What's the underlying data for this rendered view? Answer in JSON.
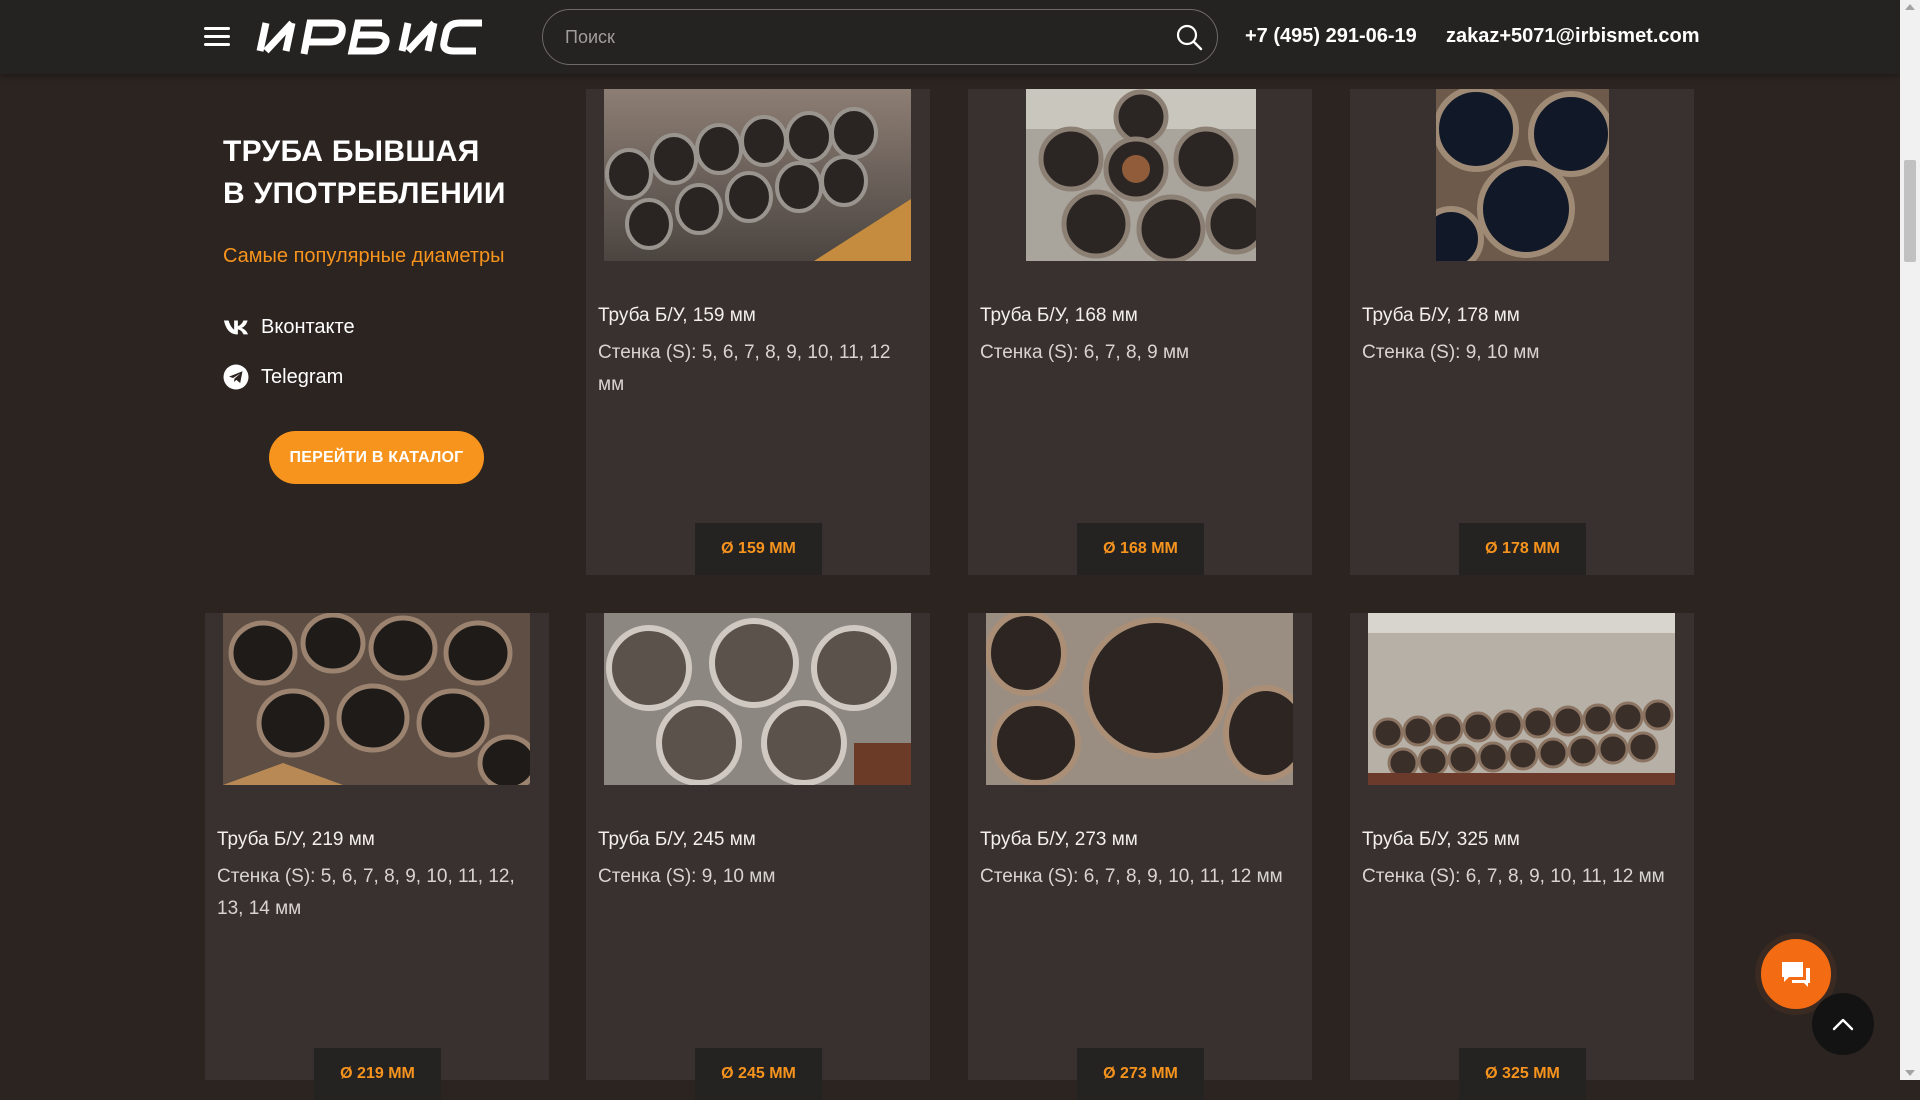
{
  "header": {
    "logo_text": "ИРБИС",
    "menu_icon": "hamburger-menu-icon",
    "search": {
      "placeholder": "Поиск",
      "value": "",
      "icon": "search-icon"
    },
    "phone": "+7 (495) 291-06-19",
    "email": "zakaz+5071@irbismet.com"
  },
  "info": {
    "title_line1": "ТРУБА БЫВШАЯ",
    "title_line2": "В УПОТРЕБЛЕНИИ",
    "subtitle": "Самые популярные диаметры",
    "social": [
      {
        "label": "Вконтакте",
        "icon": "vk-icon"
      },
      {
        "label": "Telegram",
        "icon": "telegram-icon"
      }
    ],
    "catalog_button": "ПЕРЕЙТИ В КАТАЛОГ"
  },
  "cards": [
    {
      "title": "Труба Б/У, 159 мм",
      "wall": "Стенка (S): 5, 6, 7, 8, 9, 10, 11, 12 мм",
      "badge": "Ø 159 ММ"
    },
    {
      "title": "Труба Б/У, 168 мм",
      "wall": "Стенка (S): 6, 7, 8, 9 мм",
      "badge": "Ø 168 ММ"
    },
    {
      "title": "Труба Б/У, 178 мм",
      "wall": "Стенка (S): 9, 10 мм",
      "badge": "Ø 178 ММ"
    },
    {
      "title": "Труба Б/У, 219 мм",
      "wall": "Стенка (S): 5, 6, 7, 8, 9, 10, 11, 12, 13, 14 мм",
      "badge": "Ø 219 ММ"
    },
    {
      "title": "Труба Б/У, 245 мм",
      "wall": "Стенка (S): 9, 10 мм",
      "badge": "Ø 245 ММ"
    },
    {
      "title": "Труба Б/У, 273 мм",
      "wall": "Стенка (S): 6, 7, 8, 9, 10, 11, 12 мм",
      "badge": "Ø 273 ММ"
    },
    {
      "title": "Труба Б/У, 325 мм",
      "wall": "Стенка (S): 6, 7, 8, 9, 10, 11, 12 мм",
      "badge": "Ø 325 ММ"
    }
  ],
  "floating": {
    "chat_icon": "chat-bubble-icon",
    "top_icon": "chevron-up-icon"
  },
  "colors": {
    "accent": "#f7941d",
    "background": "#2c2421",
    "card": "#383130",
    "header": "#252322",
    "chat": "#f36b12"
  }
}
